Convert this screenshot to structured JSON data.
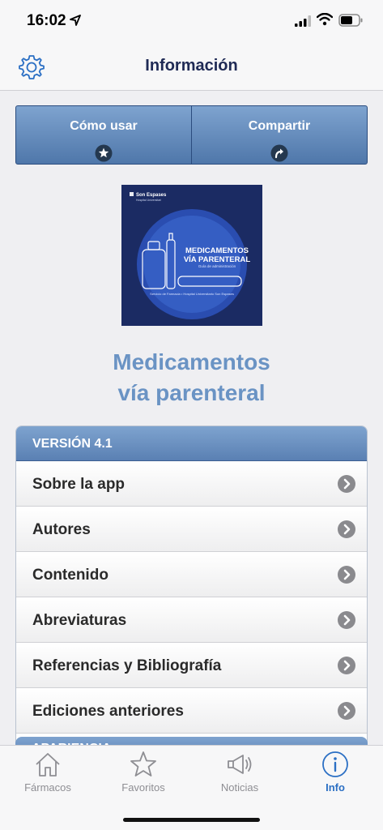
{
  "status_bar": {
    "time": "16:02"
  },
  "nav": {
    "title": "Información",
    "settings_icon": "gear-icon"
  },
  "actions": [
    {
      "label": "Cómo usar",
      "icon": "star-icon"
    },
    {
      "label": "Compartir",
      "icon": "share-icon"
    }
  ],
  "logo": {
    "brand": "Son Espases",
    "brand_sub": "Hospital Universitari",
    "title_line1": "MEDICAMENTOS",
    "title_line2": "VÍA PARENTERAL",
    "subtitle": "Guía de administración",
    "footer": "Servicio de Farmacia • Hospital Universitario Son Espases"
  },
  "app_name": {
    "line1": "Medicamentos",
    "line2": "vía parenteral"
  },
  "version": {
    "header": "VERSIÓN 4.1",
    "items": [
      {
        "label": "Sobre la app"
      },
      {
        "label": "Autores"
      },
      {
        "label": "Contenido"
      },
      {
        "label": "Abreviaturas"
      },
      {
        "label": "Referencias y Bibliografía"
      },
      {
        "label": "Ediciones anteriores"
      }
    ]
  },
  "next_section": {
    "header": "APARIENCIA"
  },
  "tabs": [
    {
      "label": "Fármacos",
      "icon": "home-icon"
    },
    {
      "label": "Favoritos",
      "icon": "star-icon"
    },
    {
      "label": "Noticias",
      "icon": "megaphone-icon"
    },
    {
      "label": "Info",
      "icon": "info-icon",
      "active": true
    }
  ],
  "colors": {
    "accent": "#2b6fc4",
    "header_blue": "#6a93c4",
    "nav_title": "#1f2a55"
  }
}
